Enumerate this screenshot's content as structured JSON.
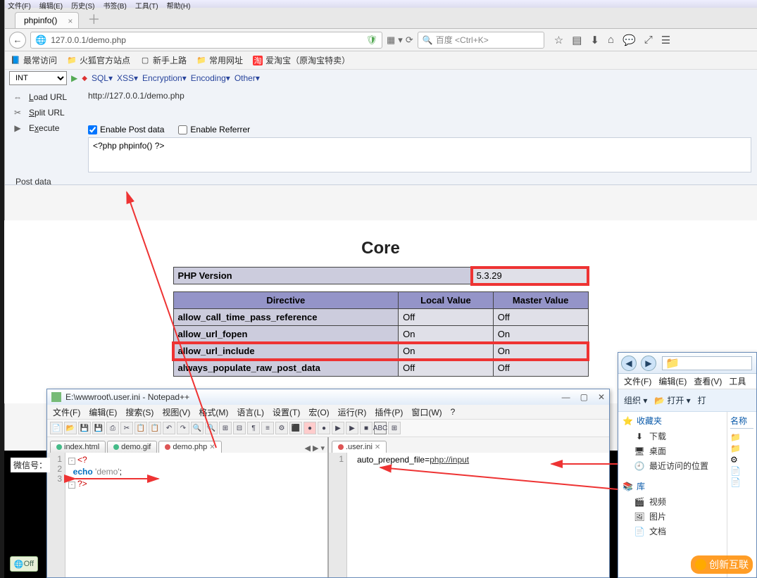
{
  "browser": {
    "menu": [
      "文件(F)",
      "编辑(E)",
      "历史(S)",
      "书签(B)",
      "工具(T)",
      "帮助(H)"
    ],
    "tab_title": "phpinfo()",
    "address": "127.0.0.1/demo.php",
    "search_placeholder": "百度 <Ctrl+K>",
    "bookmarks": [
      {
        "icon": "📘",
        "label": "最常访问"
      },
      {
        "icon": "📁",
        "label": "火狐官方站点"
      },
      {
        "icon": "▢",
        "label": "新手上路"
      },
      {
        "icon": "📁",
        "label": "常用网址"
      },
      {
        "icon": "淘",
        "label": "爱淘宝（原淘宝特卖）"
      }
    ]
  },
  "hackbar": {
    "int_select": "INT",
    "menu": [
      "SQL▾",
      "XSS▾",
      "Encryption▾",
      "Encoding▾",
      "Other▾"
    ],
    "side": [
      {
        "icon": "⇔",
        "label": "Load URL",
        "ul": "L"
      },
      {
        "icon": "✂",
        "label": "Split URL",
        "ul": "S"
      },
      {
        "icon": "▶",
        "label": "Execute",
        "ul": "x"
      }
    ],
    "loadurl_value": "http://127.0.0.1/demo.php",
    "enable_post": "Enable Post data",
    "enable_referrer": "Enable Referrer",
    "post_label": "Post data",
    "post_value": "<?php phpinfo() ?>"
  },
  "phpinfo": {
    "core_title": "Core",
    "version_label": "PHP Version",
    "version_value": "5.3.29",
    "headers": [
      "Directive",
      "Local Value",
      "Master Value"
    ],
    "rows": [
      {
        "d": "allow_call_time_pass_reference",
        "l": "Off",
        "m": "Off"
      },
      {
        "d": "allow_url_fopen",
        "l": "On",
        "m": "On"
      },
      {
        "d": "allow_url_include",
        "l": "On",
        "m": "On",
        "hl": true
      },
      {
        "d": "always_populate_raw_post_data",
        "l": "Off",
        "m": "Off"
      }
    ]
  },
  "npp": {
    "title": "E:\\wwwroot\\.user.ini - Notepad++",
    "menu": [
      "文件(F)",
      "编辑(E)",
      "搜索(S)",
      "视图(V)",
      "格式(M)",
      "语言(L)",
      "设置(T)",
      "宏(O)",
      "运行(R)",
      "插件(P)",
      "窗口(W)",
      "?"
    ],
    "left_tabs": [
      {
        "name": "index.html",
        "active": false
      },
      {
        "name": "demo.gif",
        "active": false
      },
      {
        "name": "demo.php",
        "active": true,
        "dirty": true
      }
    ],
    "right_tabs": [
      {
        "name": ".user.ini",
        "active": true,
        "dirty": true
      }
    ],
    "left_code": {
      "lines": [
        "<?",
        "  echo 'demo';",
        "?>"
      ]
    },
    "right_code": {
      "lines": [
        "auto_prepend_file=php://input"
      ]
    }
  },
  "explorer": {
    "menu": [
      "文件(F)",
      "编辑(E)",
      "查看(V)",
      "工具"
    ],
    "toolbar_organize": "组织 ▾",
    "toolbar_open": "打开 ▾",
    "toolbar_print": "打",
    "col_name": "名称",
    "fav_header": "收藏夹",
    "favs": [
      {
        "icon": "⬇",
        "label": "下载"
      },
      {
        "icon": "🖥",
        "label": "桌面"
      },
      {
        "icon": "🕘",
        "label": "最近访问的位置"
      }
    ],
    "lib_header": "库",
    "libs": [
      {
        "icon": "🎬",
        "label": "视频"
      },
      {
        "icon": "🖼",
        "label": "图片"
      },
      {
        "icon": "📄",
        "label": "文档"
      }
    ]
  },
  "misc": {
    "weixin": "微信号：",
    "offbtn": "Off",
    "watermark": "创新互联"
  }
}
